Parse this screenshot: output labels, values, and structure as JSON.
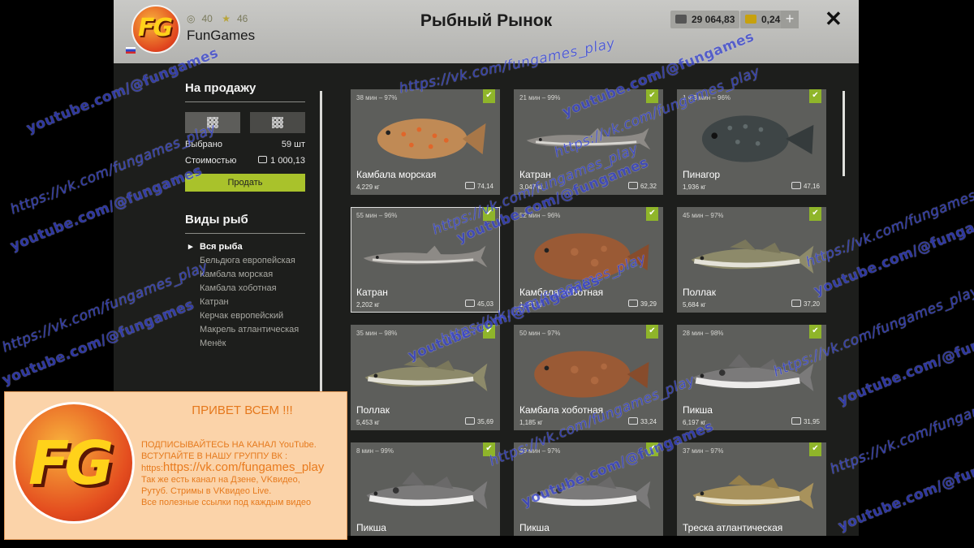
{
  "header": {
    "logo_text": "FG",
    "level": "40",
    "stars": "46",
    "player_name": "FunGames",
    "title": "Рыбный Рынок",
    "money": "29 064,83",
    "gold": "0,24",
    "add_label": "+",
    "close_label": "✕"
  },
  "sidebar": {
    "sale_title": "На продажу",
    "selected_label": "Выбрано",
    "selected_value": "59 шт",
    "cost_label": "Стоимостью",
    "cost_value": "1 000,13",
    "sell_button": "Продать",
    "fish_types_title": "Виды рыб",
    "fish_types": [
      {
        "label": "Вся рыба",
        "active": true
      },
      {
        "label": "Бельдюга европейская",
        "active": false
      },
      {
        "label": "Камбала морская",
        "active": false
      },
      {
        "label": "Камбала хоботная",
        "active": false
      },
      {
        "label": "Катран",
        "active": false
      },
      {
        "label": "Керчак европейский",
        "active": false
      },
      {
        "label": "Макрель атлантическая",
        "active": false
      },
      {
        "label": "Менёк",
        "active": false
      }
    ]
  },
  "cards": [
    {
      "time": "38 мин – 97%",
      "name": "Камбала морская",
      "weight": "4,229 кг",
      "price": "74,14",
      "fish": "plaice",
      "selected": false
    },
    {
      "time": "21 мин – 99%",
      "name": "Катран",
      "weight": "3,047 кг",
      "price": "62,32",
      "fish": "shark",
      "selected": false
    },
    {
      "time": "1 ч 3 мин – 96%",
      "name": "Пинагор",
      "weight": "1,936 кг",
      "price": "47,16",
      "fish": "lumpfish",
      "selected": false
    },
    {
      "time": "55 мин – 96%",
      "name": "Катран",
      "weight": "2,202 кг",
      "price": "45,03",
      "fish": "shark",
      "selected": true
    },
    {
      "time": "52 мин – 96%",
      "name": "Камбала хоботная",
      "weight": "1,401 кг",
      "price": "39,29",
      "fish": "flounder",
      "selected": false
    },
    {
      "time": "45 мин – 97%",
      "name": "Поллак",
      "weight": "5,684 кг",
      "price": "37,20",
      "fish": "pollock",
      "selected": false
    },
    {
      "time": "35 мин – 98%",
      "name": "Поллак",
      "weight": "5,453 кг",
      "price": "35,69",
      "fish": "pollock",
      "selected": false
    },
    {
      "time": "50 мин – 97%",
      "name": "Камбала хоботная",
      "weight": "1,185 кг",
      "price": "33,24",
      "fish": "flounder",
      "selected": false
    },
    {
      "time": "28 мин – 98%",
      "name": "Пикша",
      "weight": "6,197 кг",
      "price": "31,95",
      "fish": "haddock",
      "selected": false
    },
    {
      "time": "8 мин – 99%",
      "name": "Пикша",
      "weight": "",
      "price": "",
      "fish": "haddock",
      "selected": false
    },
    {
      "time": "49 мин – 97%",
      "name": "Пикша",
      "weight": "",
      "price": "",
      "fish": "haddock",
      "selected": false
    },
    {
      "time": "37 мин – 97%",
      "name": "Треска атлантическая",
      "weight": "",
      "price": "",
      "fish": "cod",
      "selected": false
    }
  ],
  "promo": {
    "logo_text": "FG",
    "title": "ПРИВЕТ ВСЕМ !!!",
    "line1": "ПОДПИСЫВАЙТЕСЬ НА КАНАЛ YouTube.",
    "line2": "ВСТУПАЙТЕ В НАШУ ГРУППУ ВК :",
    "line3_prefix": "https:",
    "line3_url": "https://vk.com/fungames_play",
    "line4": "Так же есть канал на Дзене, VKвидео,",
    "line5": "Рутуб. Стримы в VKвидео Live.",
    "line6": "Все полезные ссылки под каждым видео"
  },
  "watermarks": {
    "yt": "youtube.com/@fungames",
    "vk": "https://vk.com/fungames_play"
  },
  "colors": {
    "accent": "#a9c22b",
    "check": "#8fb52a",
    "watermark": "#3a46cf",
    "promo_bg": "#fbd3a9",
    "promo_text": "#e67a1d"
  }
}
